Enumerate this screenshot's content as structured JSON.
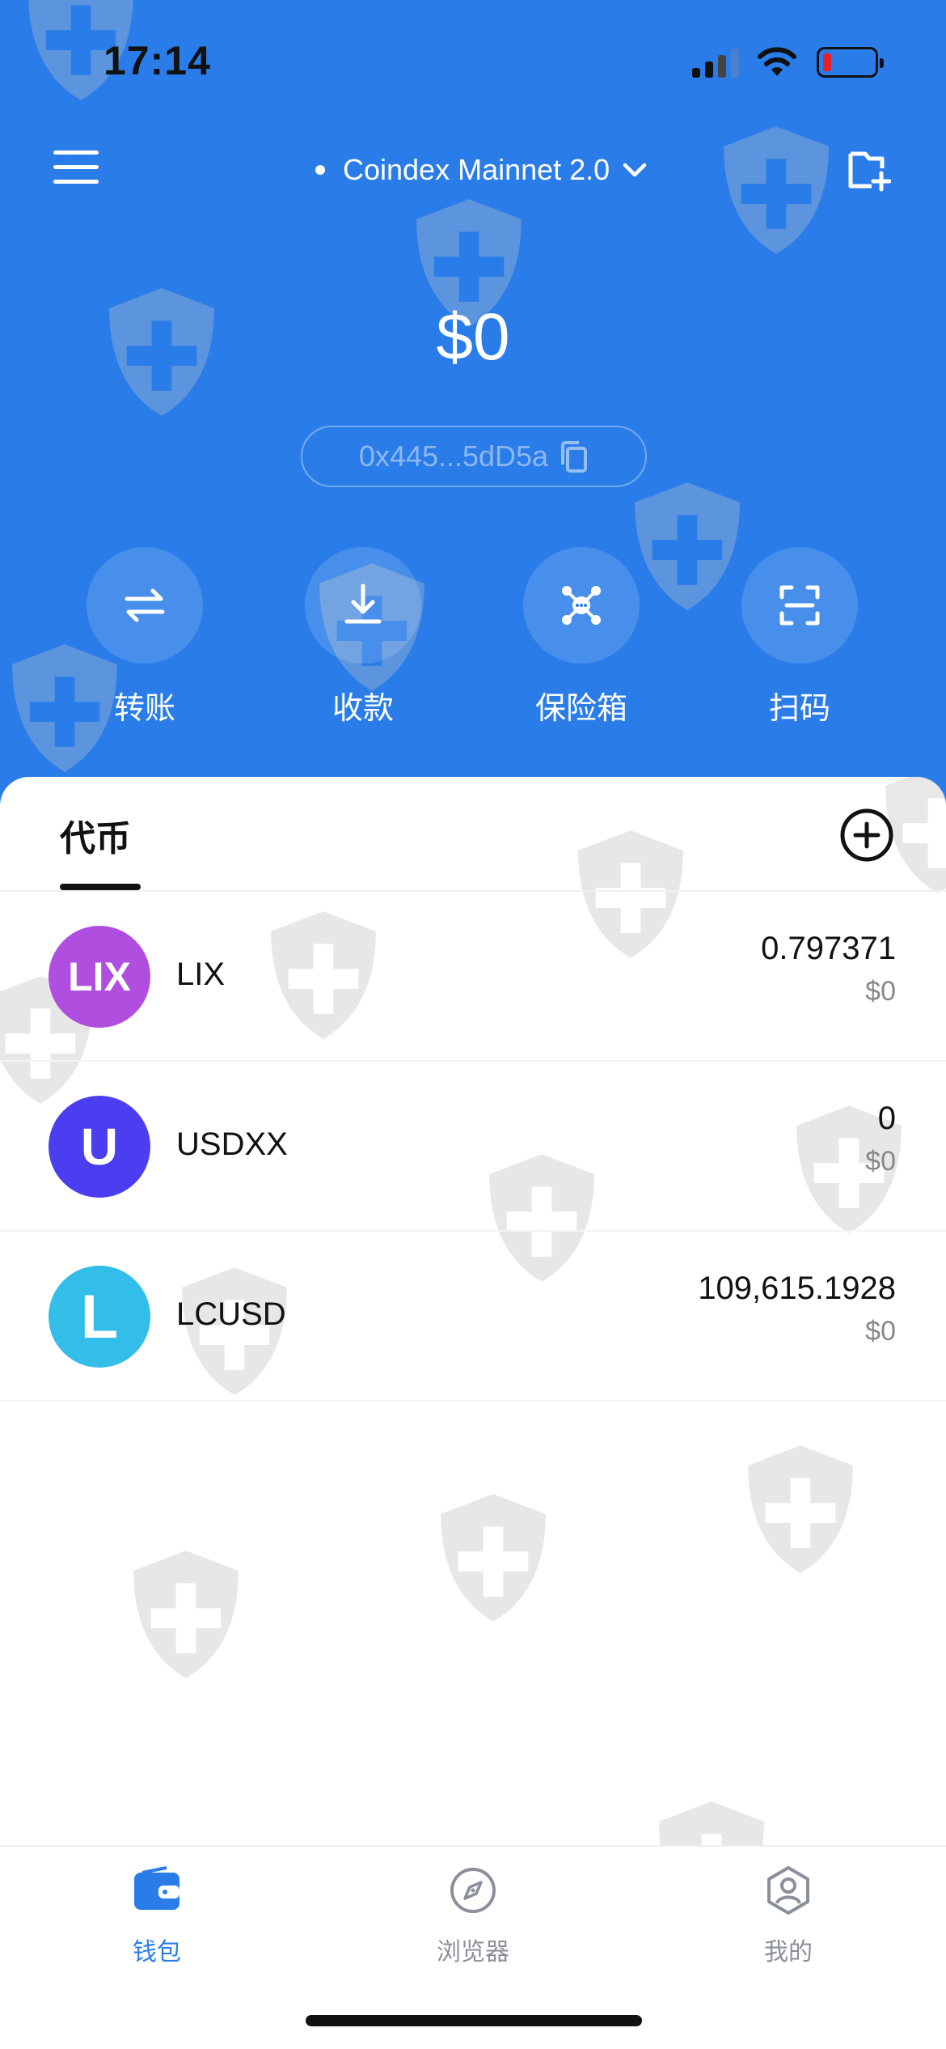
{
  "status_bar": {
    "time": "17:14"
  },
  "header": {
    "network_name": "Coindex Mainnet 2.0",
    "balance": "$0",
    "address": "0x445...5dD5a"
  },
  "actions": [
    {
      "label": "转账",
      "icon": "transfer-icon"
    },
    {
      "label": "收款",
      "icon": "receive-icon"
    },
    {
      "label": "保险箱",
      "icon": "vault-icon"
    },
    {
      "label": "扫码",
      "icon": "scan-icon"
    }
  ],
  "tabs": {
    "tokens_label": "代币"
  },
  "tokens": [
    {
      "logo_text": "LIX",
      "name": "LIX",
      "amount": "0.797371",
      "usd": "$0",
      "color": "#b04ee0"
    },
    {
      "logo_text": "U",
      "name": "USDXX",
      "amount": "0",
      "usd": "$0",
      "color": "#4b3ef0"
    },
    {
      "logo_text": "L",
      "name": "LCUSD",
      "amount": "109,615.1928",
      "usd": "$0",
      "color": "#33bde9"
    }
  ],
  "bottom_nav": [
    {
      "label": "钱包",
      "icon": "wallet-icon",
      "active": true
    },
    {
      "label": "浏览器",
      "icon": "compass-icon",
      "active": false
    },
    {
      "label": "我的",
      "icon": "profile-icon",
      "active": false
    }
  ],
  "colors": {
    "accent": "#2a7de9",
    "nav_active": "#2a7de9",
    "nav_inactive": "#8a8f99"
  }
}
